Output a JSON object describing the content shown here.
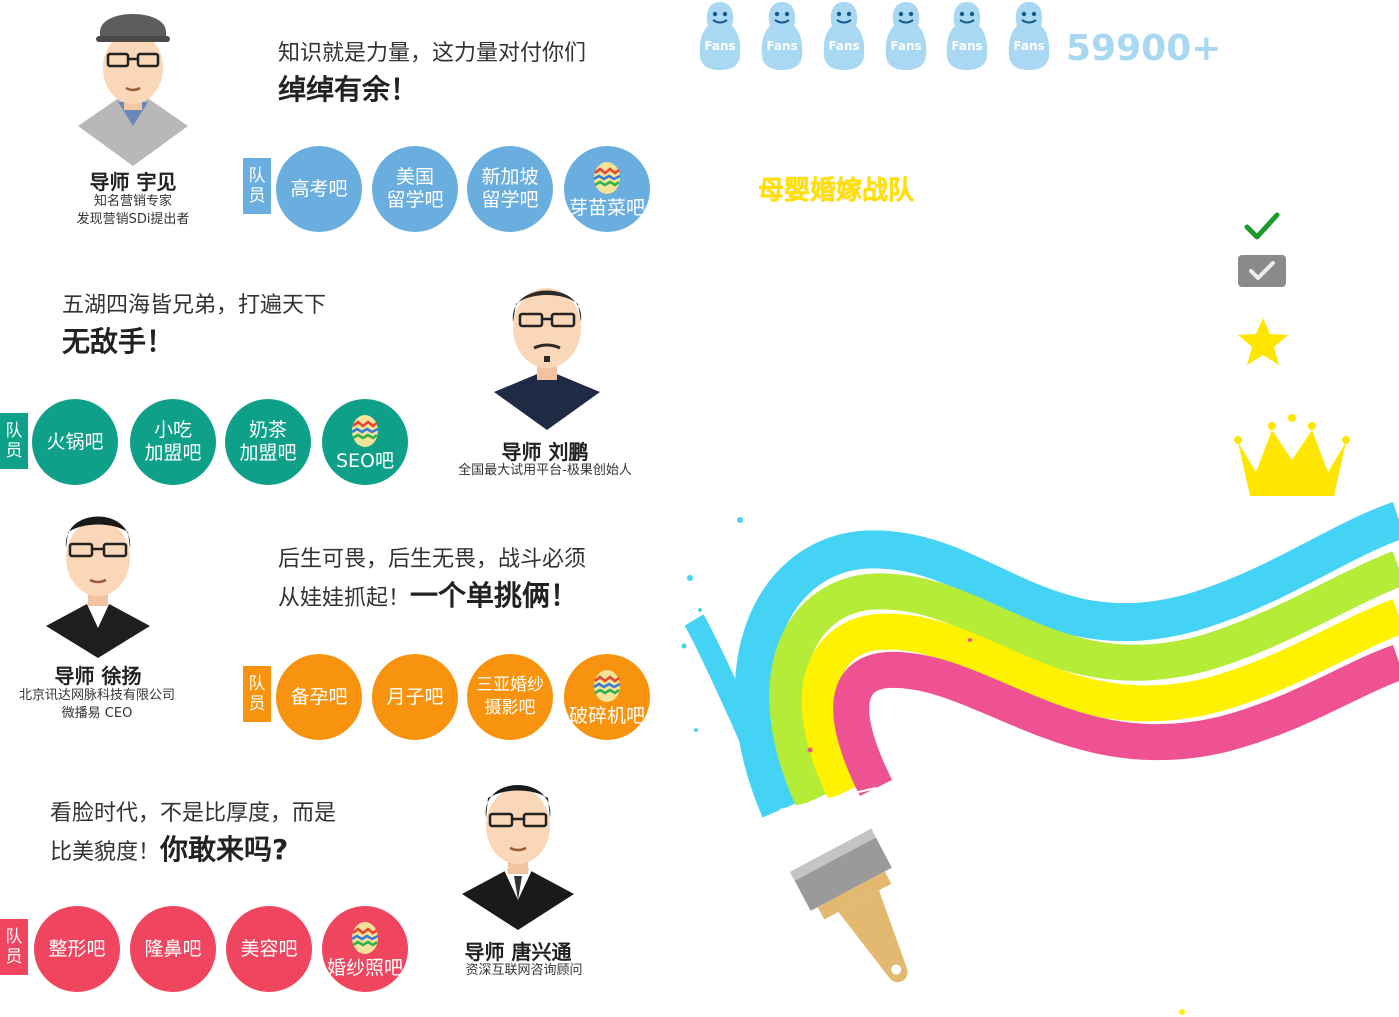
{
  "fans": {
    "icon_label": "Fans",
    "count": "59900+",
    "icon_count": 6,
    "color": "#a8d8f2"
  },
  "team_title": "母婴婚嫁战队",
  "team_label": "队员",
  "mentors": [
    {
      "name": "导师 宇见",
      "desc": [
        "知名营销专家",
        "发现营销SDi提出者"
      ],
      "slogan_line1": "知识就是力量，这力量对付你们",
      "slogan_bold": "绰绰有余！",
      "color": "#6aaee0",
      "members": [
        "高考吧",
        "美国\n留学吧",
        "新加坡\n留学吧",
        "芽苗菜吧"
      ]
    },
    {
      "name": "导师 刘鹏",
      "desc": [
        "全国最大试用平台-极果创始人"
      ],
      "slogan_line1": "五湖四海皆兄弟，打遍天下",
      "slogan_bold": "无敌手！",
      "color": "#0fa08a",
      "members": [
        "火锅吧",
        "小吃\n加盟吧",
        "奶茶\n加盟吧",
        "SEO吧"
      ]
    },
    {
      "name": "导师 徐扬",
      "desc": [
        "北京讯达网脉科技有限公司",
        "微播易 CEO"
      ],
      "slogan_line1": "后生可畏，后生无畏，战斗必须",
      "slogan_line2": "从娃娃抓起！",
      "slogan_bold": "一个单挑俩！",
      "color": "#f7930f",
      "members": [
        "备孕吧",
        "月子吧",
        "三亚婚纱\n摄影吧",
        "破碎机吧"
      ]
    },
    {
      "name": "导师 唐兴通",
      "desc": [
        "资深互联网咨询顾问"
      ],
      "slogan_line1": "看脸时代，不是比厚度，而是",
      "slogan_line2": "比美貌度！",
      "slogan_bold": "你敢来吗?",
      "color": "#f0455e",
      "members": [
        "整形吧",
        "隆鼻吧",
        "美容吧",
        "婚纱照吧"
      ]
    }
  ],
  "sidebar_icons": [
    "check-icon",
    "checkbox-icon",
    "star-icon",
    "crown-icon"
  ],
  "colors": {
    "rainbow": [
      "#45d3f5",
      "#b4ec37",
      "#fff200",
      "#ee5293"
    ]
  }
}
